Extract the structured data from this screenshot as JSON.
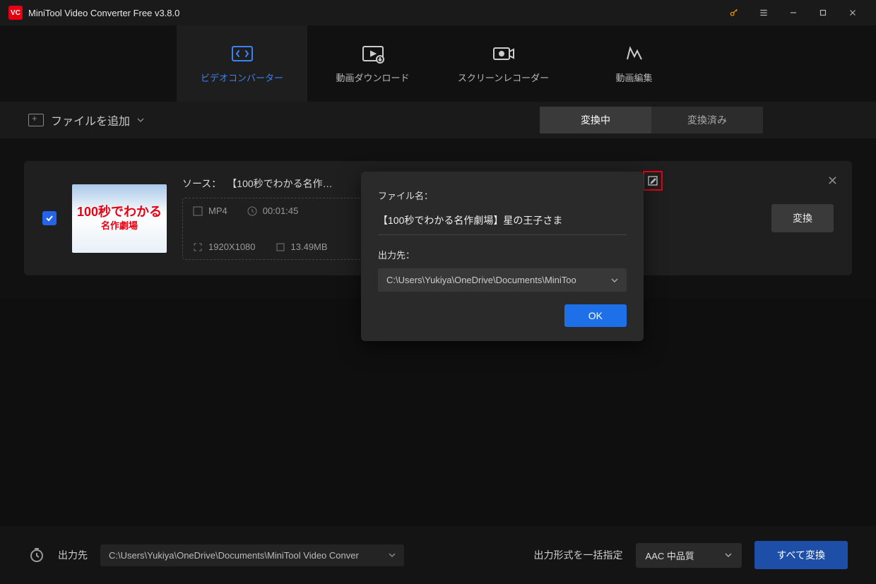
{
  "titlebar": {
    "app_name": "MiniTool Video Converter Free v3.8.0"
  },
  "maintabs": {
    "converter": "ビデオコンバーター",
    "download": "動画ダウンロード",
    "recorder": "スクリーンレコーダー",
    "edit": "動画編集"
  },
  "subbar": {
    "add_file": "ファイルを追加",
    "converting": "変換中",
    "converted": "変換済み"
  },
  "file": {
    "source_label": "ソース：",
    "source_name": "【100秒でわかる名作…",
    "format": "MP4",
    "duration": "00:01:45",
    "resolution": "1920X1080",
    "size": "13.49MB",
    "convert": "変換",
    "thumb_line1": "100秒でわかる",
    "thumb_line2": "名作劇場"
  },
  "popup": {
    "filename_label": "ファイル名：",
    "filename_value": "【100秒でわかる名作劇場】星の王子さま",
    "output_label": "出力先：",
    "output_path": "C:\\Users\\Yukiya\\OneDrive\\Documents\\MiniToo",
    "ok": "OK"
  },
  "footer": {
    "output_label": "出力先",
    "output_path": "C:\\Users\\Yukiya\\OneDrive\\Documents\\MiniTool Video Conver",
    "batch_label": "出力形式を一括指定",
    "quality": "AAC 中品質",
    "convert_all": "すべて変換"
  }
}
